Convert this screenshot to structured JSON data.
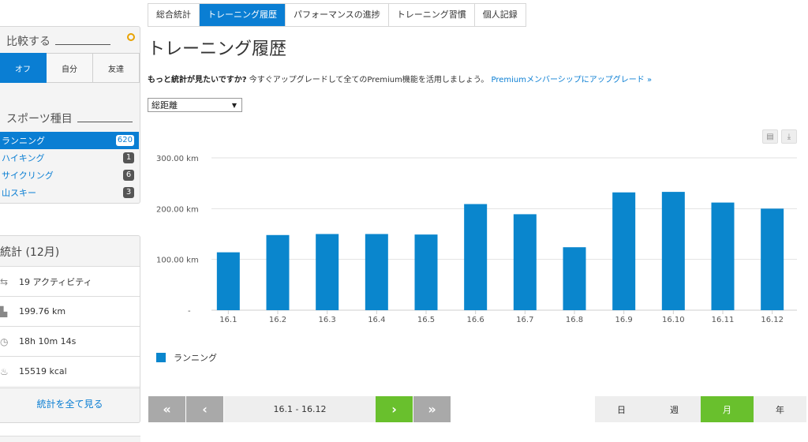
{
  "sidebar": {
    "compare": {
      "title": "比較する",
      "options": [
        "オフ",
        "自分",
        "友達"
      ]
    },
    "sports": {
      "title": "スポーツ種目",
      "items": [
        {
          "label": "ランニング",
          "count": "620"
        },
        {
          "label": "ハイキング",
          "count": "1"
        },
        {
          "label": "サイクリング",
          "count": "6"
        },
        {
          "label": "山スキー",
          "count": "3"
        }
      ]
    },
    "stats": {
      "title": "統計 (12月)",
      "rows": [
        {
          "icon": "activity-icon",
          "value": "19 アクティビティ"
        },
        {
          "icon": "distance-icon",
          "value": "199.76 km"
        },
        {
          "icon": "timer-icon",
          "value": "18h 10m 14s"
        },
        {
          "icon": "calories-icon",
          "value": "15519 kcal"
        }
      ],
      "see_all": "統計を全て見る"
    }
  },
  "tabs": [
    "総合統計",
    "トレーニング履歴",
    "パフォーマンスの進捗",
    "トレーニング習慣",
    "個人記録"
  ],
  "page_title": "トレーニング履歴",
  "promo": {
    "bold": "もっと統計が見たいですか?",
    "text": " 今すぐアップグレードして全てのPremium機能を活用しましょう。",
    "link": "Premiumメンバーシップにアップグレード »"
  },
  "metric_select": "総距離",
  "chart_data": {
    "type": "bar",
    "categories": [
      "16.1",
      "16.2",
      "16.3",
      "16.4",
      "16.5",
      "16.6",
      "16.7",
      "16.8",
      "16.9",
      "16.10",
      "16.11",
      "16.12"
    ],
    "series": [
      {
        "name": "ランニング",
        "values": [
          114,
          148,
          150,
          150,
          149,
          209,
          189,
          124,
          232,
          233,
          212,
          200
        ],
        "color": "#0a86cd"
      }
    ],
    "yticks": [
      "-",
      "100.00 km",
      "200.00 km",
      "300.00 km"
    ],
    "ylim": [
      0,
      300
    ],
    "grid": true,
    "legend_position": "bottom-left"
  },
  "pager": {
    "range": "16.1 - 16.12",
    "first": "«",
    "prev": "‹",
    "next": "›",
    "last": "»"
  },
  "period": {
    "options": [
      "日",
      "週",
      "月",
      "年"
    ],
    "active": "月"
  },
  "colors": {
    "accent": "#0a7ed3",
    "bar": "#0a86cd",
    "green": "#69c02d"
  }
}
